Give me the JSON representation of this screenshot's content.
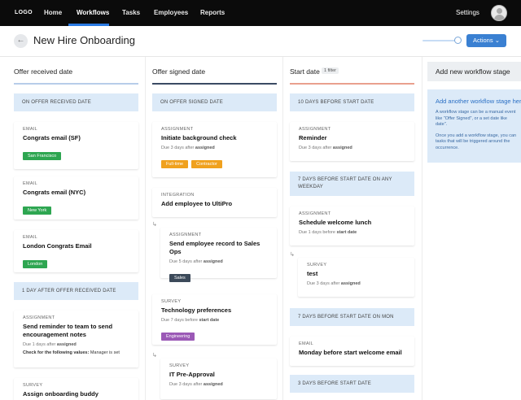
{
  "nav": {
    "logo": "LOGO",
    "items": [
      {
        "label": "Home"
      },
      {
        "label": "Workflows"
      },
      {
        "label": "Tasks"
      },
      {
        "label": "Employees"
      },
      {
        "label": "Reports"
      }
    ],
    "active": "Workflows",
    "settings": "Settings"
  },
  "header": {
    "title": "New Hire Onboarding",
    "actions_label": "Actions",
    "back_icon": "arrow-left-icon"
  },
  "colors": {
    "accent": "#3a80d2",
    "stage_bg": "#dceaf8",
    "tag_green": "#2ea651",
    "tag_orange": "#f0a11e",
    "tag_dark": "#3c4a5a",
    "tag_purple": "#9b59b6"
  },
  "columns": [
    {
      "title": "Offer received date",
      "stages": [
        {
          "label": "ON OFFER RECEIVED DATE"
        },
        {
          "label": "1 DAY AFTER OFFER RECEIVED DATE"
        }
      ],
      "cards": [
        {
          "type": "EMAIL",
          "name": "Congrats email (SF)",
          "tag": "San Francisco"
        },
        {
          "type": "EMAIL",
          "name": "Congrats email (NYC)",
          "tag": "New York"
        },
        {
          "type": "EMAIL",
          "name": "London Congrats Email",
          "tag": "London"
        },
        {
          "type": "ASSIGNMENT",
          "name": "Send reminder to team to send encouragement notes",
          "due_prefix": "Due 1 days after",
          "due_suffix": "assigned",
          "check": "Check for the following values:",
          "check_value": "Manager is set"
        },
        {
          "type": "SURVEY",
          "name": "Assign onboarding buddy"
        }
      ]
    },
    {
      "title": "Offer signed date",
      "stages": [
        {
          "label": "ON OFFER SIGNED DATE"
        }
      ],
      "cards": [
        {
          "type": "ASSIGNMENT",
          "name": "Initiate background check",
          "due_prefix": "Due 3 days after",
          "due_suffix": "assigned",
          "tags": [
            "Full-time",
            "Contractor"
          ]
        },
        {
          "type": "INTEGRATION",
          "name": "Add employee to UltiPro"
        },
        {
          "type": "ASSIGNMENT",
          "name": "Send employee record to Sales Ops",
          "due_prefix": "Due 5 days after",
          "due_suffix": "assigned",
          "tag": "Sales"
        },
        {
          "type": "SURVEY",
          "name": "Technology preferences",
          "due_prefix": "Due 7 days before",
          "due_suffix": "start date",
          "tag": "Engineering"
        },
        {
          "type": "SURVEY",
          "name": "IT Pre-Approval",
          "due_prefix": "Due 3 days after",
          "due_suffix": "assigned"
        }
      ]
    },
    {
      "title": "Start date",
      "filter": "1 filter",
      "stages": [
        {
          "label": "10 DAYS BEFORE START DATE"
        },
        {
          "label": "7 DAYS BEFORE START DATE ON ANY WEEKDAY"
        },
        {
          "label": "7 DAYS BEFORE START DATE ON MON"
        },
        {
          "label": "3 DAYS BEFORE START DATE"
        }
      ],
      "cards": [
        {
          "type": "ASSIGNMENT",
          "name": "Reminder",
          "due_prefix": "Due 3 days after",
          "due_suffix": "assigned"
        },
        {
          "type": "ASSIGNMENT",
          "name": "Schedule welcome lunch",
          "due_prefix": "Due 1 days before",
          "due_suffix": "start date"
        },
        {
          "type": "SURVEY",
          "name": "test",
          "due_prefix": "Due 3 days after",
          "due_suffix": "assigned"
        },
        {
          "type": "EMAIL",
          "name": "Monday before start welcome email"
        }
      ]
    }
  ],
  "add_stage": {
    "label": "Add new workflow stage",
    "info_title": "Add another workflow stage here",
    "info_line1": "A workflow stage can be a manual event",
    "info_line2": "like \"Offer Signed\", or a set date like",
    "info_line3": "date\".",
    "info_line4": "Once you add a workflow stage, you can",
    "info_line5": "tasks that will be triggered around the",
    "info_line6": "occurrence."
  }
}
